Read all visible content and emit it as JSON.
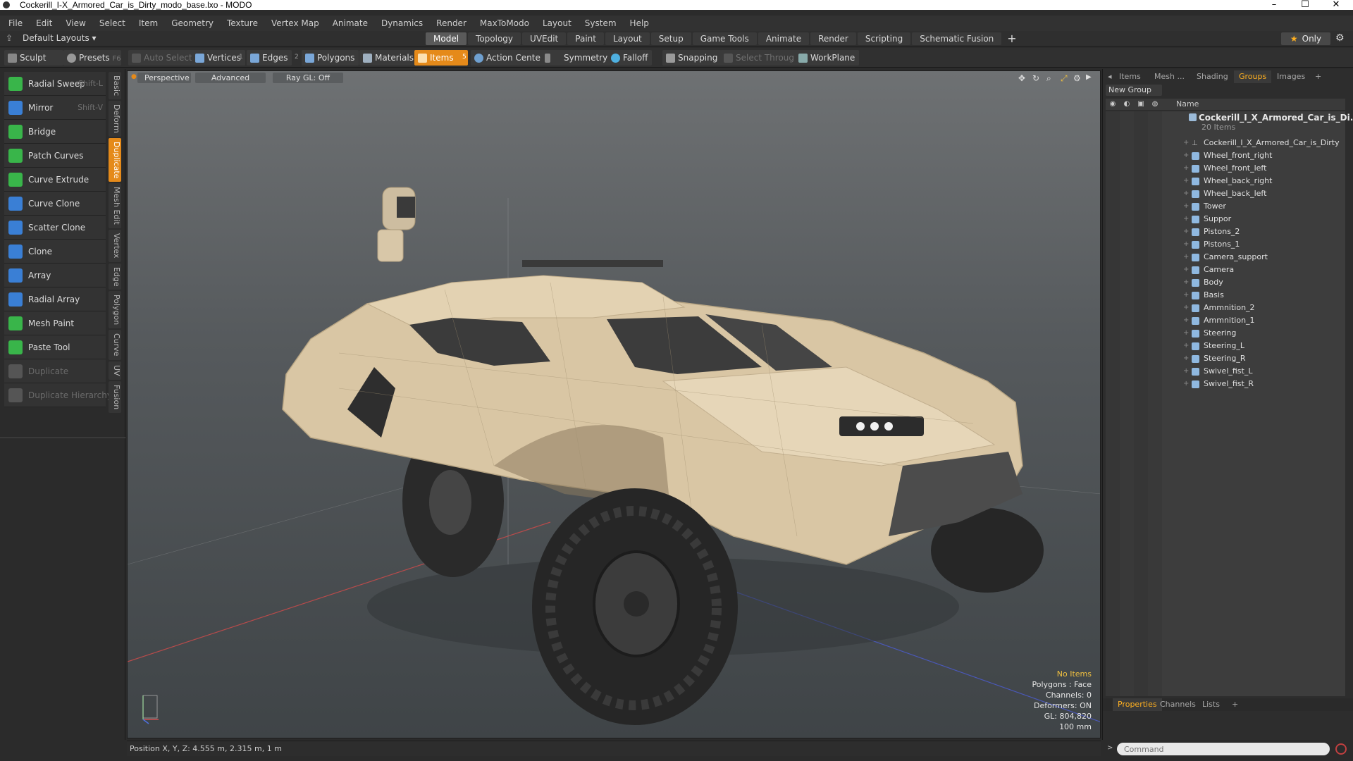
{
  "window": {
    "title": "Cockerill_I-X_Armored_Car_is_Dirty_modo_base.lxo - MODO",
    "minimize": "–",
    "maximize": "☐",
    "close": "✕"
  },
  "menu": [
    "File",
    "Edit",
    "View",
    "Select",
    "Item",
    "Geometry",
    "Texture",
    "Vertex Map",
    "Animate",
    "Dynamics",
    "Render",
    "MaxToModo",
    "Layout",
    "System",
    "Help"
  ],
  "layoutbar": {
    "layouts_label": "Default Layouts ▾",
    "tabs": [
      "Model",
      "Topology",
      "UVEdit",
      "Paint",
      "Layout",
      "Setup",
      "Game Tools",
      "Animate",
      "Render",
      "Scripting",
      "Schematic Fusion"
    ],
    "active_tab": "Model",
    "add": "+",
    "only_star": "★",
    "only_label": "Only",
    "gear": "⚙"
  },
  "toolbar": {
    "sculpt": "Sculpt",
    "presets": "Presets",
    "presets_key": "F6",
    "auto_select": "Auto Select",
    "vertices": "Vertices",
    "vertices_num": "1",
    "edges": "Edges",
    "edges_num": "2",
    "polygons": "Polygons",
    "materials": "Materials",
    "items": "Items",
    "items_num": "5",
    "action_center": "Action Center",
    "symmetry": "Symmetry",
    "falloff": "Falloff",
    "snapping": "Snapping",
    "select_through": "Select Through",
    "workplane": "WorkPlane"
  },
  "tools": [
    {
      "label": "Radial Sweep",
      "shortcut": "Shift-L",
      "color": "#39b54a"
    },
    {
      "label": "Mirror",
      "shortcut": "Shift-V",
      "color": "#3a7fd5"
    },
    {
      "label": "Bridge",
      "shortcut": "",
      "color": "#39b54a"
    },
    {
      "label": "Patch Curves",
      "shortcut": "",
      "color": "#39b54a"
    },
    {
      "label": "Curve Extrude",
      "shortcut": "",
      "color": "#39b54a"
    },
    {
      "label": "Curve Clone",
      "shortcut": "",
      "color": "#3a7fd5"
    },
    {
      "label": "Scatter Clone",
      "shortcut": "",
      "color": "#3a7fd5"
    },
    {
      "label": "Clone",
      "shortcut": "",
      "color": "#3a7fd5"
    },
    {
      "label": "Array",
      "shortcut": "",
      "color": "#3a7fd5"
    },
    {
      "label": "Radial Array",
      "shortcut": "",
      "color": "#3a7fd5"
    },
    {
      "label": "Mesh Paint",
      "shortcut": "",
      "color": "#39b54a"
    },
    {
      "label": "Paste Tool",
      "shortcut": "",
      "color": "#39b54a"
    },
    {
      "label": "Duplicate",
      "shortcut": "",
      "color": "#555555",
      "disabled": true
    },
    {
      "label": "Duplicate Hierarchy",
      "shortcut": "",
      "color": "#555555",
      "disabled": true
    }
  ],
  "vtabs": [
    "Basic",
    "Deform",
    "Duplicate",
    "Mesh Edit",
    "Vertex",
    "Edge",
    "Polygon",
    "Curve",
    "UV",
    "Fusion"
  ],
  "active_vtab": "Duplicate",
  "viewport": {
    "perspective": "Perspective",
    "advanced": "Advanced",
    "raygl": "Ray GL: Off",
    "info": {
      "no_items": "No Items",
      "polygons": "Polygons : Face",
      "channels": "Channels: 0",
      "deformers": "Deformers: ON",
      "gl": "GL: 804,820",
      "scale": "100 mm"
    }
  },
  "status": {
    "position": "Position X, Y, Z:  4.555 m, 2.315 m, 1 m"
  },
  "right_panel": {
    "tabs": [
      "Items",
      "Mesh ...",
      "Shading",
      "Groups",
      "Images"
    ],
    "active_tab": "Groups",
    "add_tab": "+",
    "new_group": "New Group",
    "name_header": "Name",
    "root_group": "Cockerill_I_X_Armored_Car_is_Di...",
    "root_count": "20 Items",
    "items": [
      {
        "label": "Cockerill_I_X_Armored_Car_is_Dirty",
        "type": "locator"
      },
      {
        "label": "Wheel_front_right",
        "type": "mesh"
      },
      {
        "label": "Wheel_front_left",
        "type": "mesh"
      },
      {
        "label": "Wheel_back_right",
        "type": "mesh"
      },
      {
        "label": "Wheel_back_left",
        "type": "mesh"
      },
      {
        "label": "Tower",
        "type": "mesh"
      },
      {
        "label": "Suppor",
        "type": "mesh"
      },
      {
        "label": "Pistons_2",
        "type": "mesh"
      },
      {
        "label": "Pistons_1",
        "type": "mesh"
      },
      {
        "label": "Camera_support",
        "type": "mesh"
      },
      {
        "label": "Camera",
        "type": "mesh"
      },
      {
        "label": "Body",
        "type": "mesh"
      },
      {
        "label": "Basis",
        "type": "mesh"
      },
      {
        "label": "Ammnition_2",
        "type": "mesh"
      },
      {
        "label": "Ammnition_1",
        "type": "mesh"
      },
      {
        "label": "Steering",
        "type": "mesh"
      },
      {
        "label": "Steering_L",
        "type": "mesh"
      },
      {
        "label": "Steering_R",
        "type": "mesh"
      },
      {
        "label": "Swivel_fist_L",
        "type": "mesh"
      },
      {
        "label": "Swivel_fist_R",
        "type": "mesh"
      }
    ],
    "props_tabs": [
      "Properties",
      "Channels",
      "Lists"
    ],
    "active_props_tab": "Properties",
    "command_placeholder": "Command"
  },
  "colors": {
    "accent": "#e58a1a",
    "active_tab_text": "#ffb020"
  }
}
